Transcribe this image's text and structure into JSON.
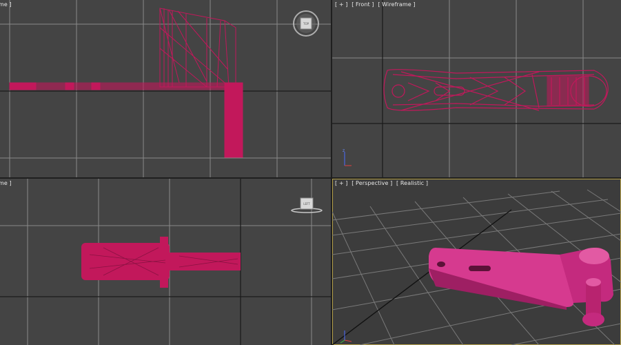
{
  "viewports": {
    "top_left": {
      "label_text": "me ]"
    },
    "top_right": {
      "labels": [
        "[ + ]",
        "[ Front ]",
        "[ Wireframe ]"
      ]
    },
    "bottom_left": {
      "label_text": "me ]"
    },
    "bottom_right": {
      "labels": [
        "[ + ]",
        "[ Perspective ]",
        "[ Realistic ]"
      ],
      "active": true
    }
  },
  "viewcube": {
    "top_face": "TOP",
    "left_face": "LEFT"
  },
  "colors": {
    "viewport_bg": "#444444",
    "grid": "#8a8a8a",
    "grid_major": "#1a1a1a",
    "object": "#c2185b",
    "object_realistic": "#d63a8f",
    "active_border": "#b6a24a"
  },
  "icons": [
    "viewcube-top-icon",
    "viewcube-left-icon",
    "axis-tripod-icon"
  ]
}
